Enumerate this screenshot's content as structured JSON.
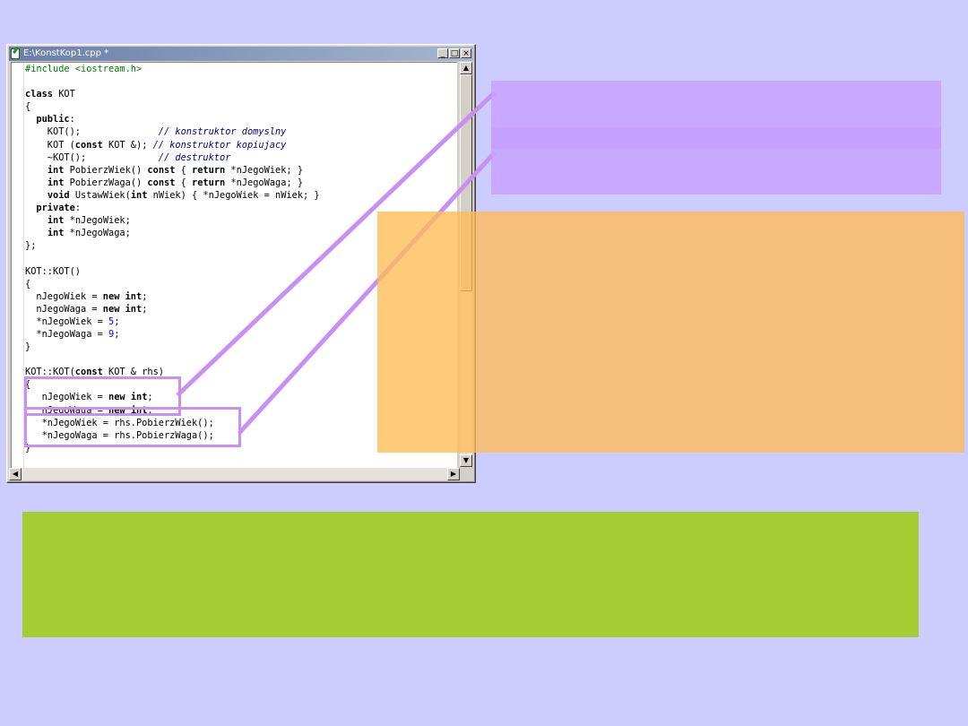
{
  "window": {
    "title": "E:\\KonstKop1.cpp *",
    "minimize_glyph": "_",
    "maximize_glyph": "□",
    "close_glyph": "×"
  },
  "scrollbar": {
    "up_glyph": "▲",
    "down_glyph": "▼",
    "left_glyph": "◀",
    "right_glyph": "▶"
  },
  "code_lines": [
    [
      {
        "t": "pp",
        "s": "#include <iostream.h>"
      }
    ],
    [],
    [
      {
        "t": "kw",
        "s": "class"
      },
      {
        "t": "",
        "s": " KOT"
      }
    ],
    [
      {
        "t": "",
        "s": "{"
      }
    ],
    [
      {
        "t": "",
        "s": "  "
      },
      {
        "t": "kw",
        "s": "public"
      },
      {
        "t": "",
        "s": ":"
      }
    ],
    [
      {
        "t": "",
        "s": "    KOT();              "
      },
      {
        "t": "cm",
        "s": "// konstruktor domyslny"
      }
    ],
    [
      {
        "t": "",
        "s": "    KOT ("
      },
      {
        "t": "kw",
        "s": "const"
      },
      {
        "t": "",
        "s": " KOT &); "
      },
      {
        "t": "cm",
        "s": "// konstruktor kopiujacy"
      }
    ],
    [
      {
        "t": "",
        "s": "    ~KOT();             "
      },
      {
        "t": "cm",
        "s": "// destruktor"
      }
    ],
    [
      {
        "t": "",
        "s": "    "
      },
      {
        "t": "kw",
        "s": "int"
      },
      {
        "t": "",
        "s": " PobierzWiek() "
      },
      {
        "t": "kw",
        "s": "const"
      },
      {
        "t": "",
        "s": " { "
      },
      {
        "t": "kw",
        "s": "return"
      },
      {
        "t": "",
        "s": " *nJegoWiek; }"
      }
    ],
    [
      {
        "t": "",
        "s": "    "
      },
      {
        "t": "kw",
        "s": "int"
      },
      {
        "t": "",
        "s": " PobierzWaga() "
      },
      {
        "t": "kw",
        "s": "const"
      },
      {
        "t": "",
        "s": " { "
      },
      {
        "t": "kw",
        "s": "return"
      },
      {
        "t": "",
        "s": " *nJegoWaga; }"
      }
    ],
    [
      {
        "t": "",
        "s": "    "
      },
      {
        "t": "kw",
        "s": "void"
      },
      {
        "t": "",
        "s": " UstawWiek("
      },
      {
        "t": "kw",
        "s": "int"
      },
      {
        "t": "",
        "s": " nWiek) { *nJegoWiek = nWiek; }"
      }
    ],
    [
      {
        "t": "",
        "s": "  "
      },
      {
        "t": "kw",
        "s": "private"
      },
      {
        "t": "",
        "s": ":"
      }
    ],
    [
      {
        "t": "",
        "s": "    "
      },
      {
        "t": "kw",
        "s": "int"
      },
      {
        "t": "",
        "s": " *nJegoWiek;"
      }
    ],
    [
      {
        "t": "",
        "s": "    "
      },
      {
        "t": "kw",
        "s": "int"
      },
      {
        "t": "",
        "s": " *nJegoWaga;"
      }
    ],
    [
      {
        "t": "",
        "s": "};"
      }
    ],
    [],
    [
      {
        "t": "",
        "s": "KOT::KOT()"
      }
    ],
    [
      {
        "t": "",
        "s": "{"
      }
    ],
    [
      {
        "t": "",
        "s": "  nJegoWiek = "
      },
      {
        "t": "kw",
        "s": "new"
      },
      {
        "t": "",
        "s": " "
      },
      {
        "t": "kw",
        "s": "int"
      },
      {
        "t": "",
        "s": ";"
      }
    ],
    [
      {
        "t": "",
        "s": "  nJegoWaga = "
      },
      {
        "t": "kw",
        "s": "new"
      },
      {
        "t": "",
        "s": " "
      },
      {
        "t": "kw",
        "s": "int"
      },
      {
        "t": "",
        "s": ";"
      }
    ],
    [
      {
        "t": "",
        "s": "  *nJegoWiek = "
      },
      {
        "t": "num",
        "s": "5"
      },
      {
        "t": "",
        "s": ";"
      }
    ],
    [
      {
        "t": "",
        "s": "  *nJegoWaga = "
      },
      {
        "t": "num",
        "s": "9"
      },
      {
        "t": "",
        "s": ";"
      }
    ],
    [
      {
        "t": "",
        "s": "}"
      }
    ],
    [],
    [
      {
        "t": "",
        "s": "KOT::KOT("
      },
      {
        "t": "kw",
        "s": "const"
      },
      {
        "t": "",
        "s": " KOT & rhs)"
      }
    ],
    [
      {
        "t": "",
        "s": "{"
      }
    ],
    [
      {
        "t": "",
        "s": "   nJegoWiek = "
      },
      {
        "t": "kw",
        "s": "new"
      },
      {
        "t": "",
        "s": " "
      },
      {
        "t": "kw",
        "s": "int"
      },
      {
        "t": "",
        "s": ";"
      }
    ],
    [
      {
        "t": "",
        "s": "   nJegoWaga = "
      },
      {
        "t": "kw",
        "s": "new"
      },
      {
        "t": "",
        "s": " "
      },
      {
        "t": "kw",
        "s": "int"
      },
      {
        "t": "",
        "s": ";"
      }
    ],
    [
      {
        "t": "",
        "s": "   *nJegoWiek = rhs.PobierzWiek();"
      }
    ],
    [
      {
        "t": "",
        "s": "   *nJegoWaga = rhs.PobierzWaga();"
      }
    ],
    [
      {
        "t": "",
        "s": "}"
      }
    ]
  ],
  "colors": {
    "background": "#ccccff",
    "purple_box": "#c8a0ff",
    "orange_box": "#ffbb55",
    "green_box": "#a6cc33",
    "highlight": "#c890f0"
  }
}
